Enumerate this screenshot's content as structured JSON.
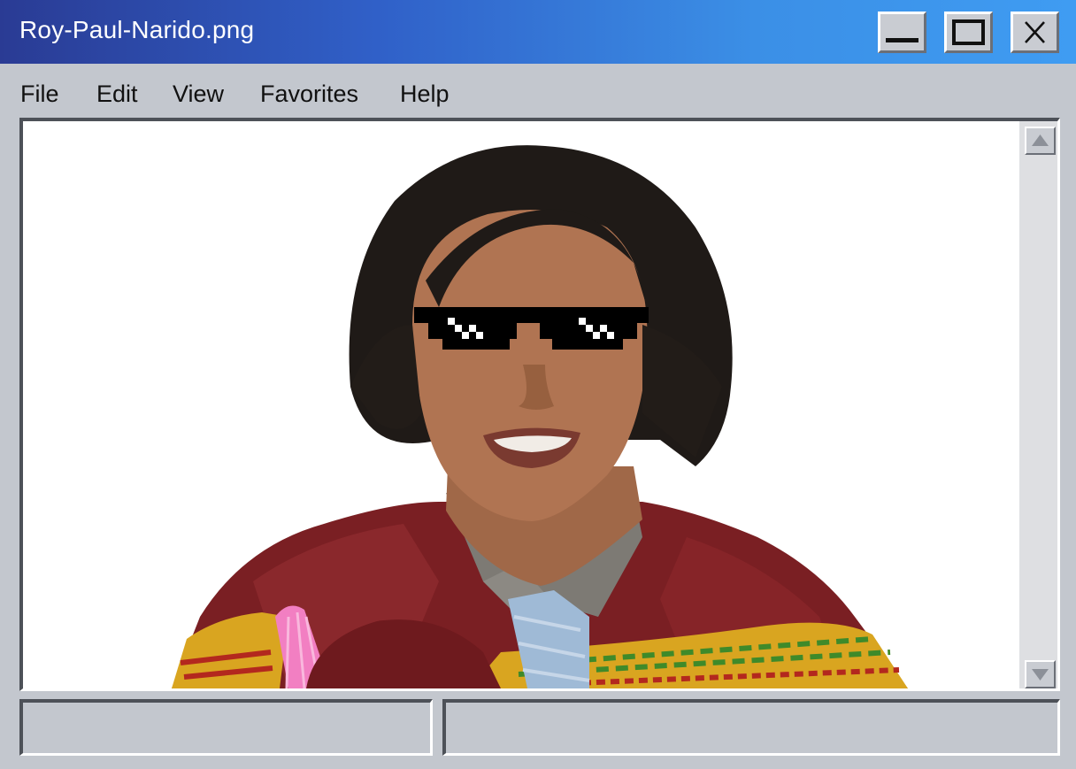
{
  "window": {
    "title": "Roy-Paul-Narido.png",
    "controls": {
      "minimize": "minimize-icon",
      "maximize": "maximize-icon",
      "close": "close-icon"
    }
  },
  "menu": {
    "items": [
      {
        "label": "File"
      },
      {
        "label": "Edit"
      },
      {
        "label": "View"
      },
      {
        "label": "Favorites"
      },
      {
        "label": "Help"
      }
    ]
  },
  "viewer": {
    "scroll_up_icon": "triangle-up-icon",
    "scroll_down_icon": "triangle-down-icon"
  },
  "statusbar": {
    "left_text": "",
    "right_text": ""
  },
  "colors": {
    "title_gradient_start": "#2a3b94",
    "title_gradient_end": "#3f9cf2",
    "chrome": "#c3c7ce"
  }
}
